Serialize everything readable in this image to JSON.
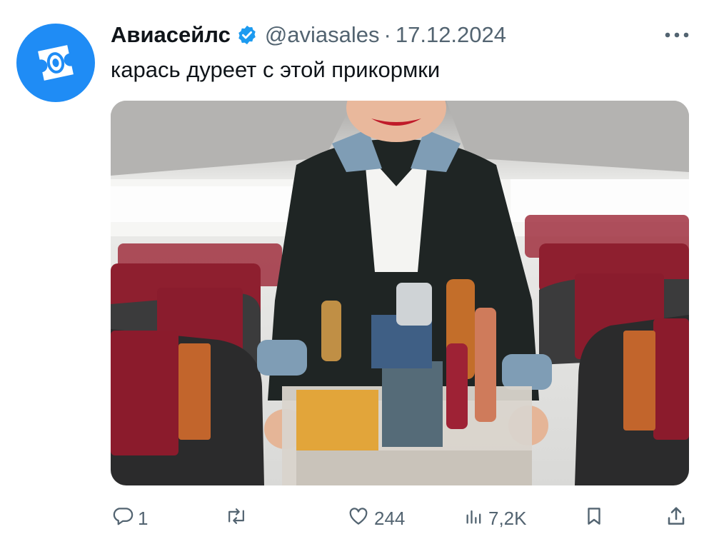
{
  "tweet": {
    "author_name": "Авиасейлс",
    "handle": "@aviasales",
    "separator": "·",
    "date": "17.12.2024",
    "text": "карась дуреет с этой прикормки"
  },
  "media": {
    "description_icon": "photo-flight-attendant-cart"
  },
  "actions": {
    "replies": "1",
    "reposts": "",
    "likes": "244",
    "views": "7,2K"
  },
  "colors": {
    "brand": "#1f8cf5",
    "verified": "#1d9bf0",
    "muted": "#536471",
    "text": "#0f1419"
  }
}
